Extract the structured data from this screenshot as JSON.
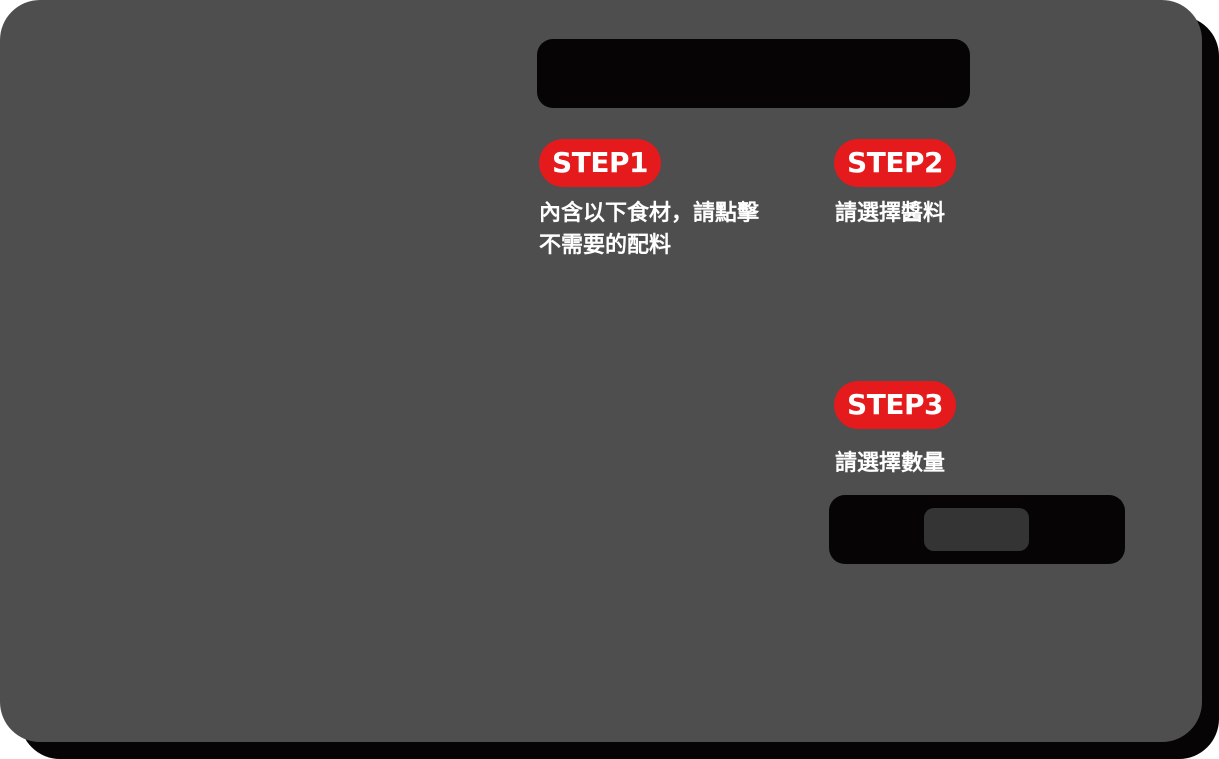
{
  "steps": {
    "step1": {
      "badge": "STEP1",
      "text_line1": "內含以下食材，請點擊",
      "text_line2": "不需要的配料"
    },
    "step2": {
      "badge": "STEP2",
      "text": "請選擇醬料"
    },
    "step3": {
      "badge": "STEP3",
      "text": "請選擇數量"
    }
  },
  "colors": {
    "card_background": "#4e4e4e",
    "shadow": "#060404",
    "badge": "#e41a1c",
    "text": "#ffffff",
    "quantity_value_box": "#343434"
  }
}
